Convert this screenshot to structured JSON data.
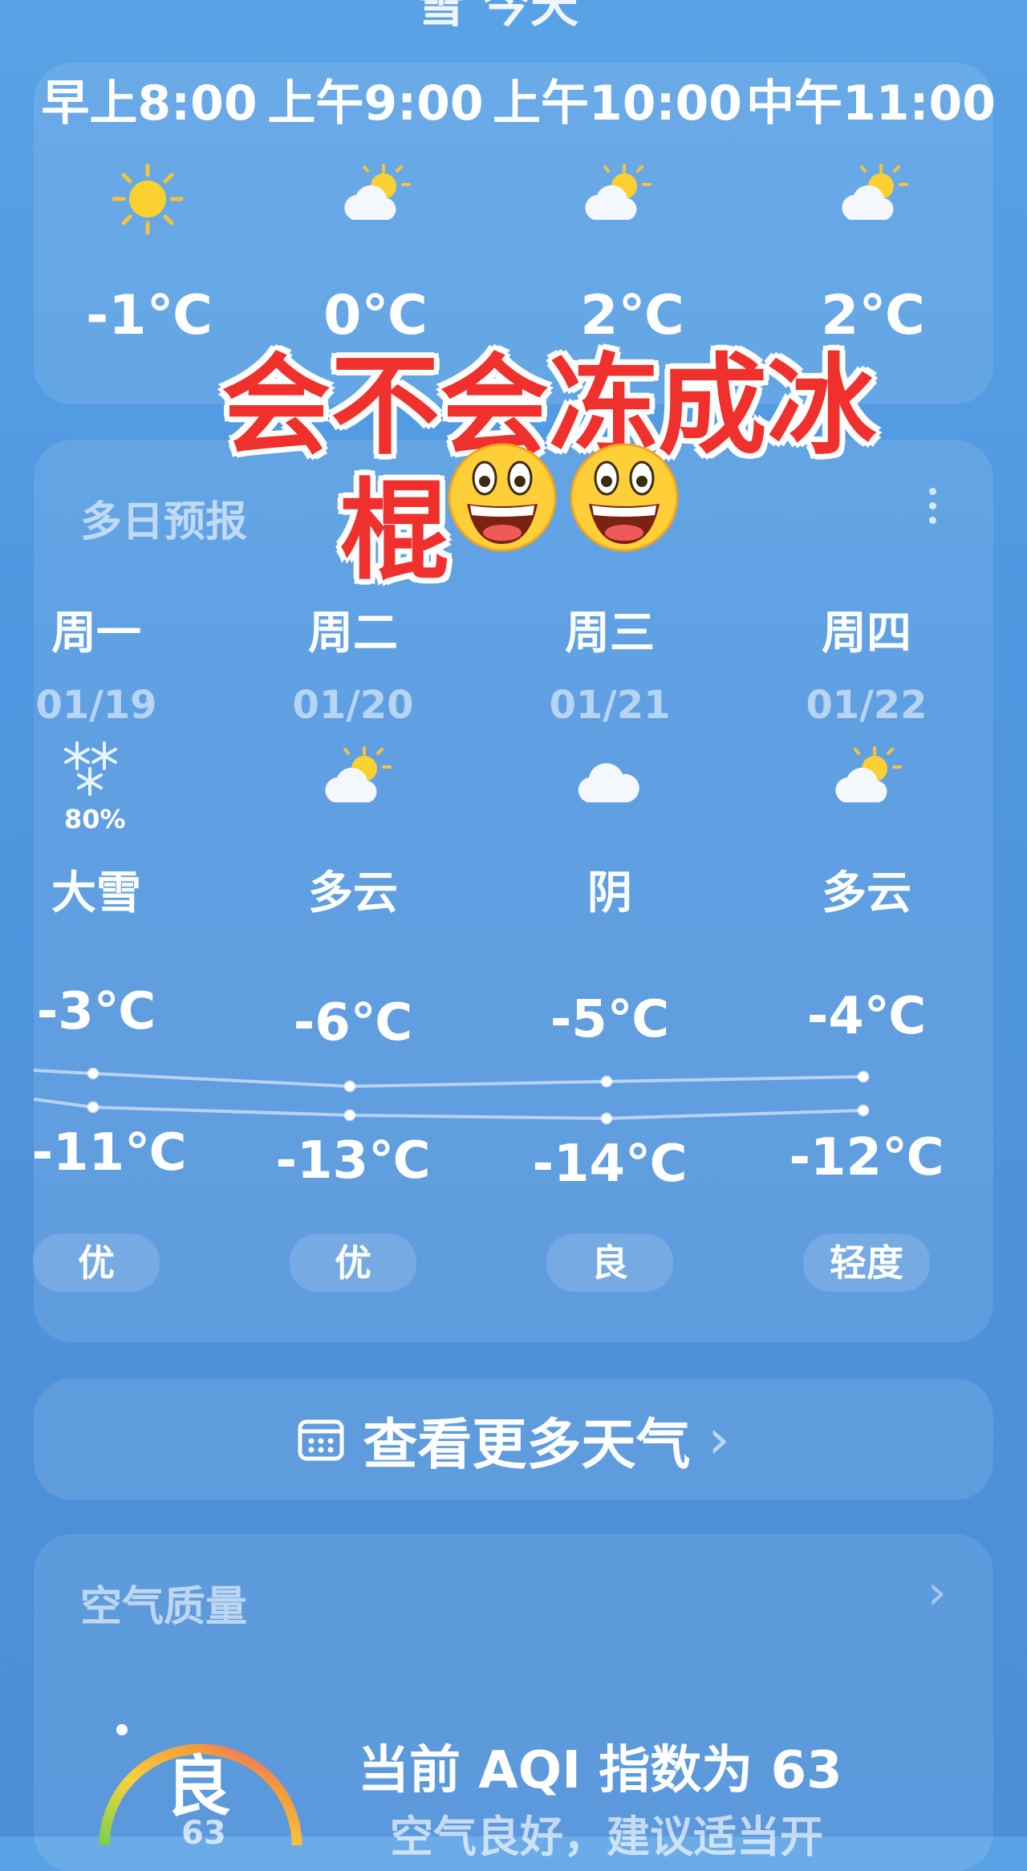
{
  "header": {
    "city_partial": "雪 今天"
  },
  "hourly": [
    {
      "time": "早上8:00",
      "temp": "-1℃",
      "icon": "sun-icon"
    },
    {
      "time": "上午9:00",
      "temp": "0℃",
      "icon": "partly-cloudy-icon"
    },
    {
      "time": "上午10:00",
      "temp": "2℃",
      "icon": "partly-cloudy-icon"
    },
    {
      "time": "中午11:00",
      "temp": "2℃",
      "icon": "partly-cloudy-icon"
    }
  ],
  "overlay": {
    "line1": "会不会冻成冰",
    "line2": "棍",
    "emoji": "😃😃"
  },
  "forecast": {
    "title": "多日预报",
    "days": [
      {
        "day": "周一",
        "date": "01/19",
        "icon": "snow-icon",
        "precip": "80%",
        "cond": "大雪",
        "hi": "-3℃",
        "lo": "-11℃",
        "aq": "优"
      },
      {
        "day": "周二",
        "date": "01/20",
        "icon": "partly-cloudy-icon",
        "precip": "",
        "cond": "多云",
        "hi": "-6℃",
        "lo": "-13℃",
        "aq": "优"
      },
      {
        "day": "周三",
        "date": "01/21",
        "icon": "cloud-icon",
        "precip": "",
        "cond": "阴",
        "hi": "-5℃",
        "lo": "-14℃",
        "aq": "良"
      },
      {
        "day": "周四",
        "date": "01/22",
        "icon": "partly-cloudy-icon",
        "precip": "",
        "cond": "多云",
        "hi": "-4℃",
        "lo": "-12℃",
        "aq": "轻度"
      }
    ]
  },
  "more_button": {
    "label": "查看更多天气",
    "arrow": "›"
  },
  "aqi": {
    "title": "空气质量",
    "level": "良",
    "value_partial": "63",
    "headline": "当前 AQI 指数为 63",
    "advice": "空气良好，建议适当开"
  },
  "colors": {
    "overlay_text": "#f0302c",
    "gauge_start": "#f7d23b",
    "gauge_end": "#e84a8f"
  }
}
